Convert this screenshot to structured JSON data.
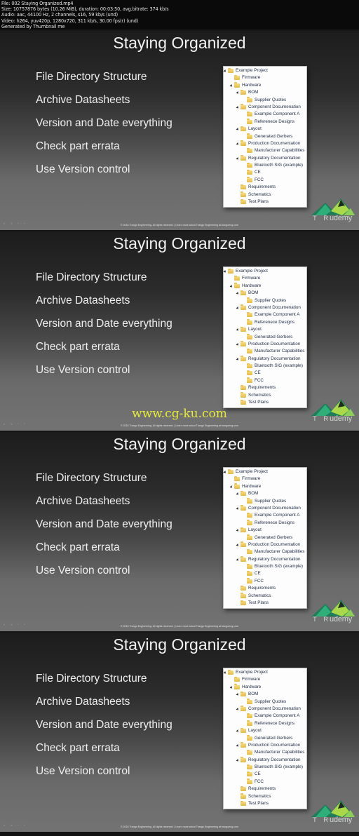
{
  "file_info": {
    "lines": [
      "File: 002 Staying Organized.mp4",
      "Size: 10757876 bytes (10.26 MiB), duration: 00:03:50, avg.bitrate: 374 kb/s",
      "Audio: aac, 44100 Hz, 2 channels, s16, 59 kb/s (und)",
      "Video: h264, yuv420p, 1280x720, 311 kb/s, 30.00 fps(r) (und)",
      "Generated by Thumbnail me"
    ]
  },
  "slide": {
    "title": "Staying Organized",
    "bullets": [
      "File Directory Structure",
      "Archive Datasheets",
      "Version and Date everything",
      "Check part errata",
      "Use Version control"
    ],
    "tree": [
      {
        "label": "Example Project",
        "level": 0,
        "expanded": true
      },
      {
        "label": "Firmware",
        "level": 1,
        "expanded": false
      },
      {
        "label": "Hardware",
        "level": 1,
        "expanded": true
      },
      {
        "label": "BOM",
        "level": 2,
        "expanded": true
      },
      {
        "label": "Supplier Quotes",
        "level": 3,
        "expanded": false
      },
      {
        "label": "Component Documenation",
        "level": 2,
        "expanded": true
      },
      {
        "label": "Example Component A",
        "level": 3,
        "expanded": false
      },
      {
        "label": "Referenece Designs",
        "level": 3,
        "expanded": false
      },
      {
        "label": "Layout",
        "level": 2,
        "expanded": true
      },
      {
        "label": "Generated Gerbers",
        "level": 3,
        "expanded": false
      },
      {
        "label": "Production Documentation",
        "level": 2,
        "expanded": true
      },
      {
        "label": "Manufacturer Capabilities",
        "level": 3,
        "expanded": false
      },
      {
        "label": "Regulatory Documentation",
        "level": 2,
        "expanded": true
      },
      {
        "label": "Bluetooth SIG (example)",
        "level": 3,
        "expanded": false
      },
      {
        "label": "CE",
        "level": 3,
        "expanded": false
      },
      {
        "label": "FCC",
        "level": 3,
        "expanded": false
      },
      {
        "label": "Requirements",
        "level": 2,
        "expanded": false
      },
      {
        "label": "Schematics",
        "level": 2,
        "expanded": false
      },
      {
        "label": "Test Plans",
        "level": 2,
        "expanded": false
      }
    ],
    "footer": "© 2015 Trango Engineering. All rights reserved.  |  Learn more about Trango Engineering at trangoeng.com",
    "logo": {
      "brand": "T R",
      "overlay": "udemy",
      "icon": "mountain-logo-icon"
    }
  },
  "frames": [
    {
      "watermark": ""
    },
    {
      "watermark": "www.cg-ku.com"
    },
    {
      "watermark": ""
    },
    {
      "watermark": ""
    }
  ],
  "colors": {
    "watermark": "#e8ea3b",
    "logo_green": "#2fae7a",
    "logo_lime": "#a9d84a"
  }
}
